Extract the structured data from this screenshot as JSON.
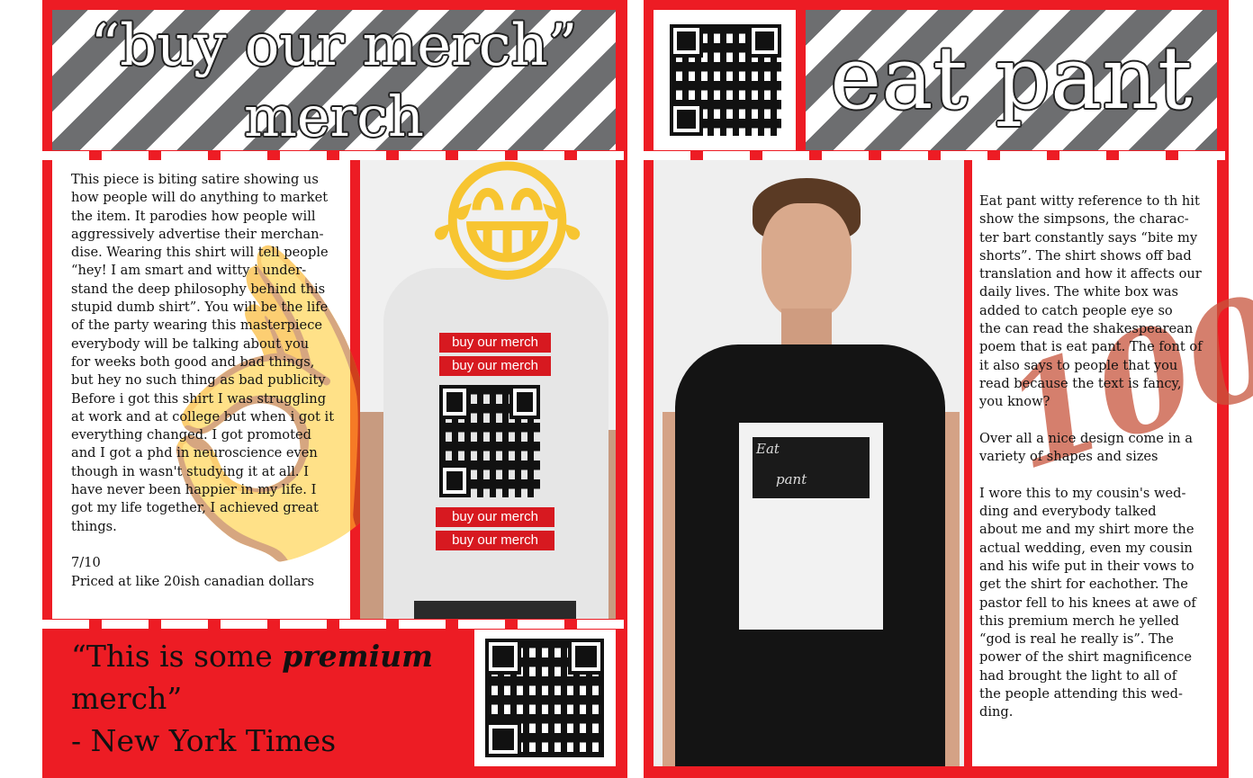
{
  "left": {
    "title_line1": "“buy our merch”",
    "title_line2": "merch",
    "description": "This piece is biting satire showing us\nhow people will do anything to market\nthe item. It parodies how people will\naggressively advertise their merchan-\ndise. Wearing this shirt will tell people\n“hey! I am smart and witty i under-\nstand the deep philosophy behind this\nstupid dumb shirt”. You will be the life\nof the party wearing this masterpiece\neverybody will be talking about you\nfor weeks both good and bad things,\nbut hey no such thing as bad publicity\nBefore i got this shirt I was struggling\nat work and at college but when i got it\neverything changed. I got promoted\nand I got a phd in neuroscience even\nthough in wasn't studying it at all. I\nhave never been happier in my life. I\ngot my life together, I achieved great\nthings.",
    "rating": "7/10",
    "price": "Priced at like 20ish canadian dollars",
    "shirt_text": [
      "buy our merch",
      "buy our merch",
      "buy our merch",
      "buy our merch"
    ],
    "quote_pre": "“This is some ",
    "quote_emph": "premium",
    "quote_post": "merch”",
    "quote_source": "- New York Times",
    "emoji_face": "😂",
    "emoji_hand": "👌"
  },
  "right": {
    "title": "eat pant",
    "description": "Eat pant witty reference to th hit\nshow the simpsons, the charac-\nter bart constantly says “bite my\nshorts”. The shirt shows off bad\ntranslation and how it affects our\ndaily lives. The white box was\nadded to catch people eye so\nthe can read the shakespearean\npoem that is eat pant. The font of\nit also says to people that you\nread because the text is fancy,\nyou know?\n\nOver all a nice design come in a\nvariety of shapes and sizes\n\nI wore this to my cousin's wed-\nding and everybody talked\nabout me and my shirt more the\nactual wedding, even my cousin\nand his wife put in their vows to\nget the shirt for eachother. The\npastor fell to his knees at awe of\nthis premium merch he yelled\n“god is real he really is”. The\npower of the shirt magnificence\nhad brought the light to all of\nthe people attending this wed-\nding.",
    "shirt_word1": "Eat",
    "shirt_word2": "pant",
    "hundred": "100"
  },
  "colors": {
    "frame_red": "#ed1c24",
    "stripe_gray": "#6d6e70",
    "shirt_black": "#141414"
  }
}
